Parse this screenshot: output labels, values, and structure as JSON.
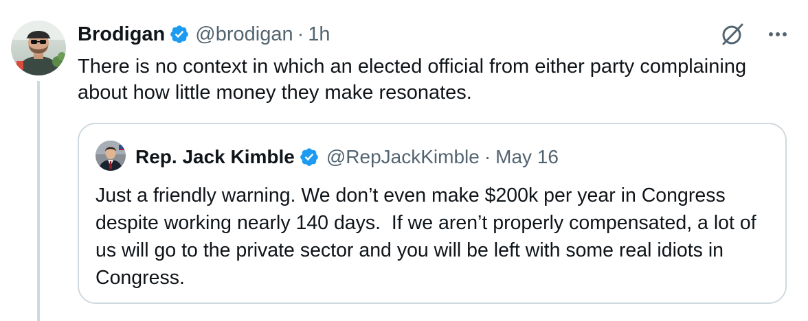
{
  "tweet": {
    "author_name": "Brodigan",
    "handle": "@brodigan",
    "separator": "·",
    "time": "1h",
    "text": "There is no context in which an elected official from either party complaining about how little money they make resonates.",
    "avatar_icon": "user-avatar-photo",
    "verified_icon": "verified-badge-icon",
    "verified_color": "#1d9bf0"
  },
  "actions": {
    "grok_icon": "grok-icon",
    "more_icon": "more-options-icon"
  },
  "quote": {
    "author_name": "Rep. Jack Kimble",
    "handle": "@RepJackKimble",
    "separator": "·",
    "time": "May 16",
    "text": "Just a friendly warning. We don’t even make $200k per year in Congress despite working nearly 140 days.  If we aren’t properly compensated, a lot of us will go to the private sector and you will be left with some real idiots in Congress.",
    "avatar_icon": "user-avatar-photo",
    "verified_icon": "verified-badge-icon"
  },
  "colors": {
    "text_primary": "#0f1419",
    "text_secondary": "#536471",
    "border": "#cfd9de",
    "thread_line": "#cfd9de"
  }
}
